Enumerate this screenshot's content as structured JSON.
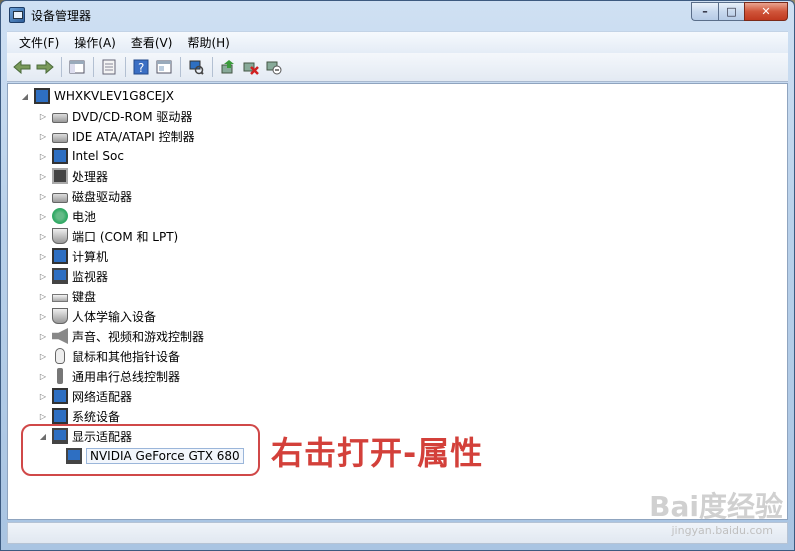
{
  "window": {
    "title": "设备管理器"
  },
  "controls": {
    "minimize": "–",
    "maximize": "□",
    "close": "✕"
  },
  "menu": {
    "items": [
      "文件(F)",
      "操作(A)",
      "查看(V)",
      "帮助(H)"
    ]
  },
  "tree": {
    "root": "WHXKVLEV1G8CEJX",
    "categories": [
      "DVD/CD-ROM 驱动器",
      "IDE ATA/ATAPI 控制器",
      "Intel Soc",
      "处理器",
      "磁盘驱动器",
      "电池",
      "端口 (COM 和 LPT)",
      "计算机",
      "监视器",
      "键盘",
      "人体学输入设备",
      "声音、视频和游戏控制器",
      "鼠标和其他指针设备",
      "通用串行总线控制器",
      "网络适配器",
      "系统设备",
      "显示适配器"
    ],
    "expanded_child": "NVIDIA GeForce GTX 680"
  },
  "annotation": {
    "text": "右击打开-属性"
  },
  "watermark": {
    "text": "Bai度经验",
    "sub": "jingyan.baidu.com"
  },
  "colors": {
    "annotation": "#d3403a",
    "selection_border": "#9bb6da"
  }
}
